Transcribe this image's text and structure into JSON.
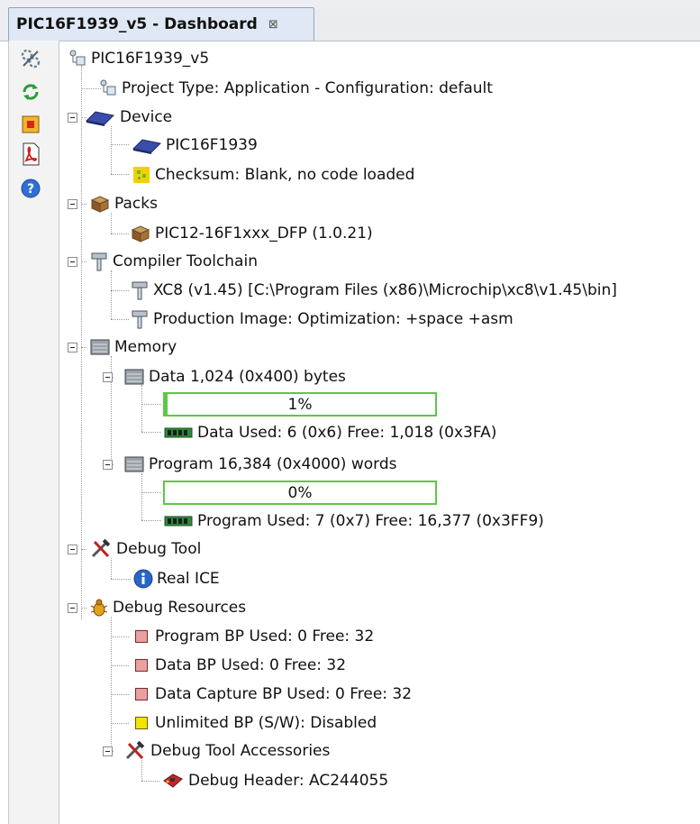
{
  "tab": {
    "title": "PIC16F1939_v5 - Dashboard",
    "close_glyph": "⊠"
  },
  "toolbar": {
    "buttons": [
      {
        "name": "settings-icon"
      },
      {
        "name": "refresh-icon"
      },
      {
        "name": "stop-icon"
      },
      {
        "name": "pdf-icon"
      },
      {
        "name": "help-icon"
      }
    ]
  },
  "tree": {
    "project": "PIC16F1939_v5",
    "project_type": "Project Type: Application - Configuration: default",
    "device": {
      "label": "Device",
      "name": "PIC16F1939",
      "checksum": "Checksum: Blank, no code loaded"
    },
    "packs": {
      "label": "Packs",
      "pack": "PIC12-16F1xxx_DFP (1.0.21)"
    },
    "compiler": {
      "label": "Compiler Toolchain",
      "xc8": "XC8 (v1.45) [C:\\Program Files (x86)\\Microchip\\xc8\\v1.45\\bin]",
      "production": "Production Image: Optimization: +space +asm"
    },
    "memory": {
      "label": "Memory",
      "data": {
        "label": "Data 1,024 (0x400) bytes",
        "percent_label": "1%",
        "fraction": 0.01,
        "used": "Data Used: 6 (0x6) Free: 1,018 (0x3FA)"
      },
      "program": {
        "label": "Program 16,384 (0x4000) words",
        "percent_label": "0%",
        "fraction": 0.0,
        "used": "Program Used: 7 (0x7) Free: 16,377 (0x3FF9)"
      }
    },
    "debug_tool": {
      "label": "Debug Tool",
      "tool": "Real ICE"
    },
    "debug_resources": {
      "label": "Debug Resources",
      "program_bp": "Program BP Used: 0  Free: 32",
      "data_bp": "Data BP Used: 0  Free: 32",
      "data_capture_bp": "Data Capture BP Used: 0  Free: 32",
      "unlimited_bp": "Unlimited BP (S/W): Disabled",
      "accessories": {
        "label": "Debug Tool Accessories",
        "header": "Debug Header: AC244055"
      }
    }
  },
  "colors": {
    "progress_border": "#5fc743",
    "bp_red": "#e8a0a0",
    "bp_yellow": "#f5e300"
  }
}
